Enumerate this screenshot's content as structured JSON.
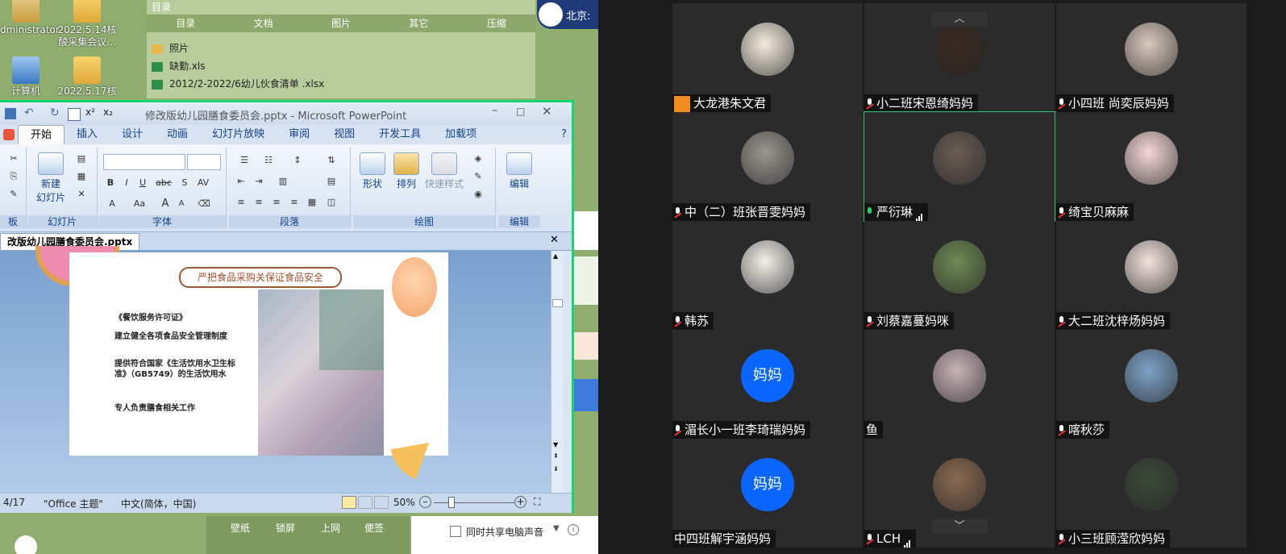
{
  "desktop": {
    "icons": [
      {
        "label": "Administrator"
      },
      {
        "label": "2022.5.14核酸采集会议..."
      },
      {
        "label": "计算机"
      },
      {
        "label": "2022.5.17核"
      }
    ],
    "explorer": {
      "title": "目录",
      "tabs": [
        "目录",
        "文档",
        "图片",
        "其它",
        "压缩"
      ],
      "files": [
        "照片",
        "缺勤.xls",
        "2012/2-2022/6幼儿伙食清单 .xlsx"
      ]
    },
    "chip_text": "北京:",
    "taskbar": [
      "壁纸",
      "锁屏",
      "上网",
      "便签"
    ],
    "share_audio": "同时共享电脑声音"
  },
  "ppt": {
    "title": "修改版幼儿园膳食委员会.pptx - Microsoft PowerPoint",
    "menu": [
      "开始",
      "插入",
      "设计",
      "动画",
      "幻灯片放映",
      "审阅",
      "视图",
      "开发工具",
      "加载项"
    ],
    "ribbon": {
      "groups": [
        "板",
        "幻灯片",
        "字体",
        "段落",
        "绘图",
        "编辑"
      ],
      "new_slide": "新建\n幻灯片",
      "shape": "形状",
      "arrange": "排列",
      "quick_style": "快速样式",
      "edit": "编辑",
      "font_buttons": [
        "B",
        "I",
        "U",
        "abc",
        "S",
        "AV",
        "A",
        "Aa",
        "A",
        "A"
      ]
    },
    "doc_tab": "改版幼儿园膳食委员会.pptx",
    "slide": {
      "heading": "严把食品采购关保证食品安全",
      "bullets": [
        "《餐饮服务许可证》",
        "建立健全各项食品安全管理制度",
        "提供符合国家《生活饮用水卫生标准》（GB5749）的生活饮用水",
        "专人负责膳食相关工作"
      ]
    },
    "status": {
      "page": "4/17",
      "theme": "\"Office 主题\"",
      "lang": "中文(简体，中国)",
      "zoom": "50%"
    }
  },
  "meeting": {
    "participants": [
      {
        "name": "大龙港朱文君",
        "mic": "host",
        "avatar_color": "#f2ecdd"
      },
      {
        "name": "小二班宋恩绮妈妈",
        "mic": "muted",
        "avatar_color": "#3a2a22"
      },
      {
        "name": "小四班 尚奕辰妈妈",
        "mic": "muted",
        "avatar_color": "#d9c8bd"
      },
      {
        "name": "中（二）班张晋雯妈妈",
        "mic": "muted",
        "avatar_color": "#9a958f"
      },
      {
        "name": "严衍琳",
        "mic": "on",
        "avatar_color": "#6b5d55"
      },
      {
        "name": "绮宝贝麻麻",
        "mic": "muted",
        "avatar_color": "#f5d7d7"
      },
      {
        "name": "韩苏",
        "mic": "muted",
        "avatar_color": "#f3efe9"
      },
      {
        "name": "刘蔡嘉蔓妈咪",
        "mic": "muted",
        "avatar_color": "#6d8a55"
      },
      {
        "name": "大二班沈梓炀妈妈",
        "mic": "muted",
        "avatar_color": "#f4e3de"
      },
      {
        "name": "湄长小一班李琦瑞妈妈",
        "mic": "muted",
        "avatar_color": "#0a66ff",
        "avatar_text": "妈妈"
      },
      {
        "name": "鱼",
        "mic": "none",
        "avatar_color": "#c9b3b8"
      },
      {
        "name": "喀秋莎",
        "mic": "muted",
        "avatar_color": "#7ea3c8"
      },
      {
        "name": "中四班解宇涵妈妈",
        "mic": "none",
        "avatar_color": "#0a66ff",
        "avatar_text": "妈妈"
      },
      {
        "name": "LCH",
        "mic": "muted",
        "avatar_color": "#8a6a52"
      },
      {
        "name": "小三班顾滢欣妈妈",
        "mic": "muted",
        "avatar_color": "#3c4a3a"
      }
    ]
  }
}
